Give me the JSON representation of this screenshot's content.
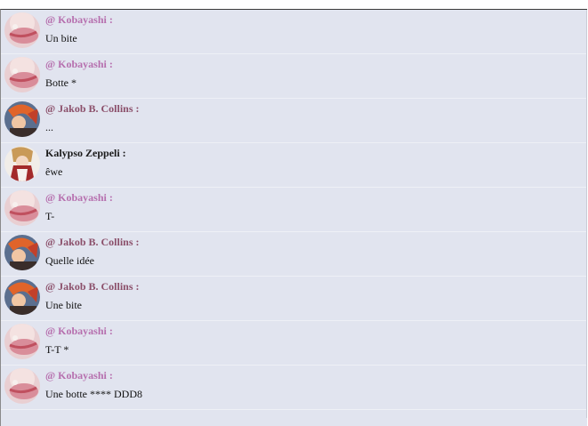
{
  "colors": {
    "kobayashi": "#b66fae",
    "jakob": "#8b4f6a",
    "kalypso": "#1a1a1a",
    "background": "#e1e4ef"
  },
  "messages": [
    {
      "author": "@ Kobayashi :",
      "text": "Un bite",
      "avatar": "kobayashi-avatar"
    },
    {
      "author": "@ Kobayashi :",
      "text": "Botte *",
      "avatar": "kobayashi-avatar"
    },
    {
      "author": "@ Jakob B. Collins :",
      "text": "...",
      "avatar": "jakob-avatar"
    },
    {
      "author": "Kalypso Zeppeli :",
      "text": "êwe",
      "avatar": "kalypso-avatar"
    },
    {
      "author": "@ Kobayashi :",
      "text": "T-",
      "avatar": "kobayashi-avatar"
    },
    {
      "author": "@ Jakob B. Collins :",
      "text": "Quelle idée",
      "avatar": "jakob-avatar"
    },
    {
      "author": "@ Jakob B. Collins :",
      "text": "Une bite",
      "avatar": "jakob-avatar"
    },
    {
      "author": "@ Kobayashi :",
      "text": "T-T *",
      "avatar": "kobayashi-avatar"
    },
    {
      "author": "@ Kobayashi :",
      "text": "Une botte **** DDD8",
      "avatar": "kobayashi-avatar"
    }
  ]
}
